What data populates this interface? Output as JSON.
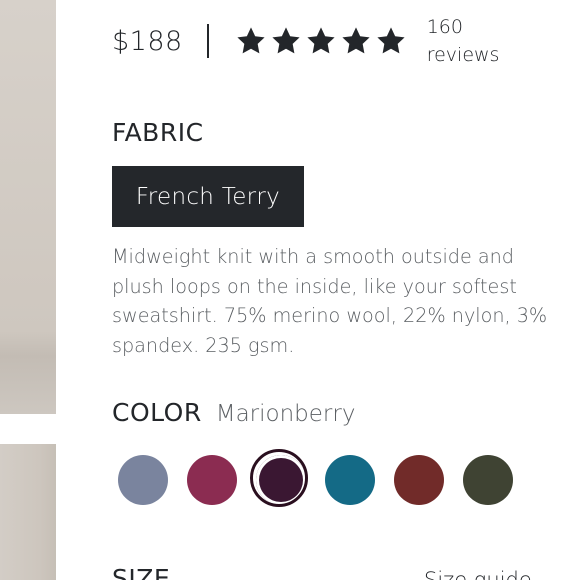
{
  "product": {
    "price": "$188",
    "rating": 5,
    "rating_max": 5,
    "reviews_count": "160",
    "reviews_label": "reviews"
  },
  "fabric": {
    "heading": "FABRIC",
    "selected": "French Terry",
    "description": "Midweight knit with a smooth outside and plush loops on the inside, like your softest sweatshirt. 75% merino wool, 22% nylon, 3% spandex. 235 gsm."
  },
  "color": {
    "heading": "COLOR",
    "selected_name": "Marionberry",
    "selected_index": 2,
    "swatches": [
      {
        "color": "#7a849e"
      },
      {
        "color": "#8b2c51"
      },
      {
        "color": "#3a1732"
      },
      {
        "color": "#146a86"
      },
      {
        "color": "#712b29"
      },
      {
        "color": "#3f4333"
      }
    ]
  },
  "size": {
    "heading": "SIZE",
    "guide_label": "Size guide"
  },
  "colors": {
    "text": "#23262a",
    "muted_text": "#5b5f63",
    "button_bg": "#24272b",
    "selected_ring": "#2a0f1f"
  }
}
